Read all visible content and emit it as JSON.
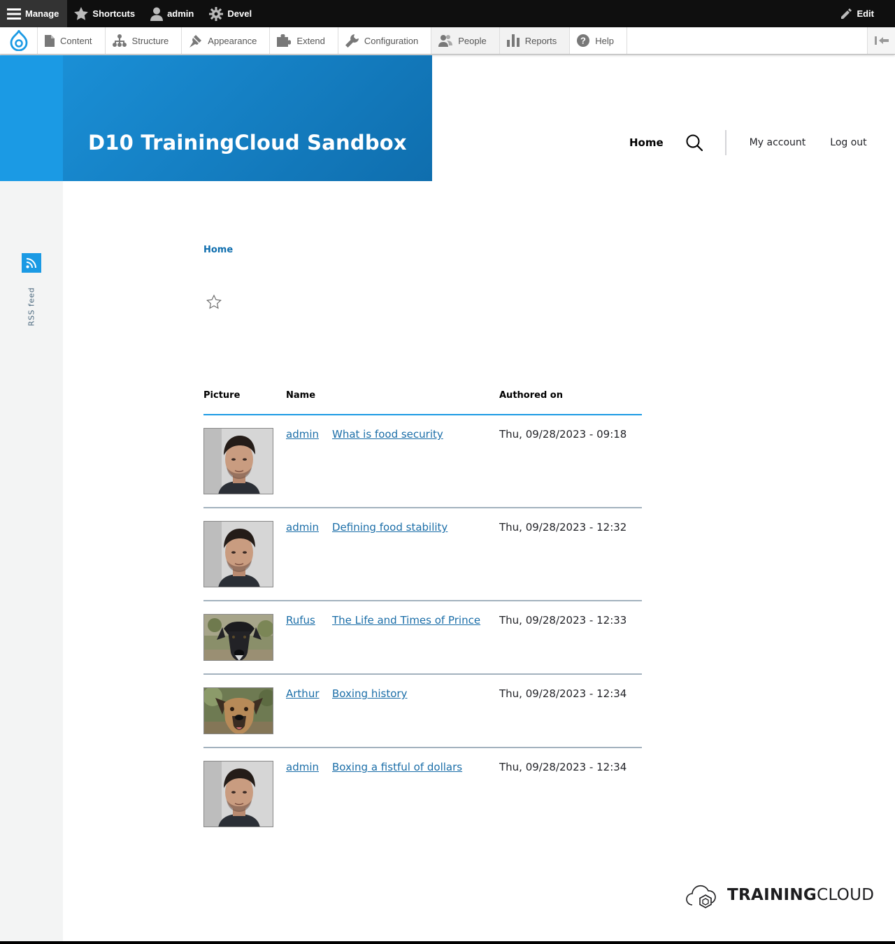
{
  "admin_toolbar": {
    "manage_label": "Manage",
    "shortcuts_label": "Shortcuts",
    "user_label": "admin",
    "devel_label": "Devel",
    "edit_label": "Edit"
  },
  "admin_tray": {
    "items": [
      "Content",
      "Structure",
      "Appearance",
      "Extend",
      "Configuration",
      "People",
      "Reports",
      "Help"
    ]
  },
  "site": {
    "name": "D10 TrainingCloud Sandbox",
    "nav_home": "Home",
    "nav_my_account": "My account",
    "nav_log_out": "Log out",
    "accent_color": "#1b9ae4",
    "link_color": "#1b6ea8"
  },
  "sidebar": {
    "rss_label": "RSS feed"
  },
  "breadcrumb": {
    "home": "Home"
  },
  "table": {
    "headers": {
      "picture": "Picture",
      "name": "Name",
      "authored_on": "Authored on"
    },
    "rows": [
      {
        "author": "admin",
        "title": "What is food security",
        "date": "Thu, 09/28/2023 - 09:18",
        "picture": "man-avatar"
      },
      {
        "author": "admin",
        "title": "Defining food stability",
        "date": "Thu, 09/28/2023 - 12:32",
        "picture": "man-avatar"
      },
      {
        "author": "Rufus",
        "title": "The Life and Times of Prince",
        "date": "Thu, 09/28/2023 - 12:33",
        "picture": "black-dog-avatar"
      },
      {
        "author": "Arthur",
        "title": "Boxing history",
        "date": "Thu, 09/28/2023 - 12:34",
        "picture": "tan-dog-avatar"
      },
      {
        "author": "admin",
        "title": "Boxing a fistful of dollars",
        "date": "Thu, 09/28/2023 - 12:34",
        "picture": "man-avatar"
      }
    ]
  },
  "footer": {
    "logo_word_1": "TRAINING",
    "logo_word_2": "CLOUD"
  }
}
